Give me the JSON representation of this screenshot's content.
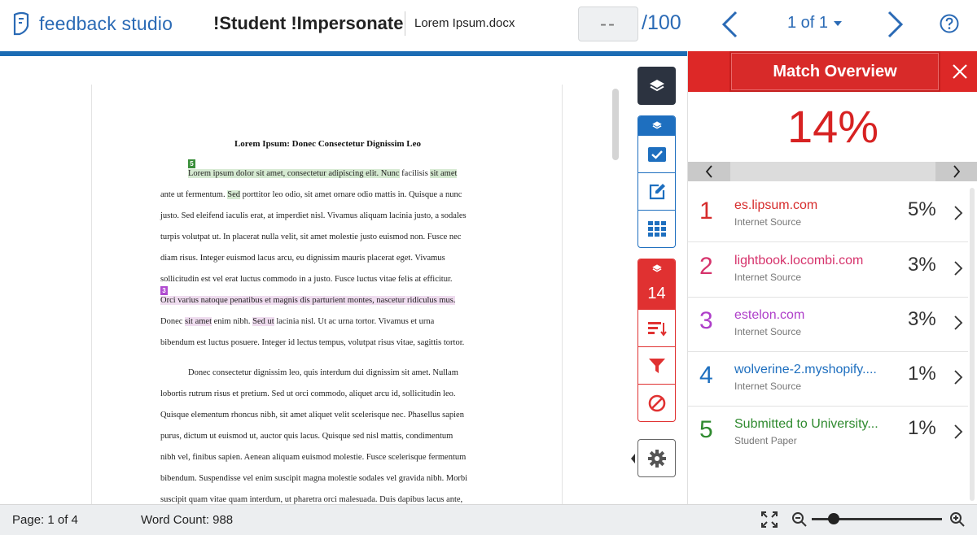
{
  "header": {
    "app_name": "feedback studio",
    "student_name": "!Student !Impersonate",
    "document_name": "Lorem Ipsum.docx",
    "grade_value": "--",
    "grade_max": "/100",
    "page_selector": "1 of 1"
  },
  "document": {
    "title": "Lorem Ipsum: Donec Consectetur Dignissim Leo",
    "badge_green": "5",
    "badge_purple": "3",
    "p1": {
      "l1_hl": "Lorem ipsum dolor sit amet, consectetur adipiscing elit. Nunc",
      "l1_mid": " facilisis ",
      "l1_hl2": "sit amet",
      "l2_a": "ante ut fermentum. ",
      "l2_hl": "Sed",
      "l2_b": " porttitor leo odio, sit amet ornare odio mattis in. Quisque a nunc",
      "l3": "justo. Sed eleifend iaculis erat, at imperdiet nisl. Vivamus aliquam lacinia justo, a sodales",
      "l4": "turpis volutpat ut. In placerat nulla velit, sit amet molestie justo euismod non. Fusce nec",
      "l5": "diam risus. Integer euismod lacus arcu, eu dignissim mauris placerat eget. Vivamus",
      "l6": "sollicitudin est vel erat luctus commodo in a justo. Fusce luctus vitae felis at efficitur.",
      "l7_hl": "Orci varius natoque penatibus et magnis dis parturient montes, nascetur ridiculus mus.",
      "l8_a": "Donec ",
      "l8_hl": "sit amet",
      "l8_b": " enim nibh. ",
      "l8_hl2": "Sed ut",
      "l8_c": " lacinia nisl. Ut ac urna tortor. Vivamus et urna",
      "l9": "bibendum est luctus posuere. Integer id lectus tempus, volutpat risus vitae, sagittis tortor."
    },
    "p2": {
      "l1": "Donec consectetur dignissim leo, quis interdum dui dignissim sit amet. Nullam",
      "l2": "lobortis rutrum risus et pretium. Sed ut orci commodo, aliquet arcu id, sollicitudin leo.",
      "l3": "Quisque elementum rhoncus nibh, sit amet aliquet velit scelerisque nec. Phasellus sapien",
      "l4": "purus, dictum ut euismod ut, auctor quis lacus. Quisque sed nisl mattis, condimentum",
      "l5": "nibh vel, finibus sapien. Aenean aliquam euismod molestie. Fusce scelerisque fermentum",
      "l6": "bibendum. Suspendisse vel enim suscipit magna molestie sodales vel gravida nibh. Morbi",
      "l7": "suscipit quam vitae quam interdum, ut pharetra orci malesuada. Duis dapibus lacus ante,"
    }
  },
  "tools": {
    "similarity_count": "14"
  },
  "panel": {
    "title": "Match Overview",
    "overall_percent": "14%",
    "matches": [
      {
        "num": "1",
        "source": "es.lipsum.com",
        "type": "Internet Source",
        "percent": "5%",
        "color": "#d62b2b"
      },
      {
        "num": "2",
        "source": "lightbook.locombi.com",
        "type": "Internet Source",
        "percent": "3%",
        "color": "#d6336c"
      },
      {
        "num": "3",
        "source": "estelon.com",
        "type": "Internet Source",
        "percent": "3%",
        "color": "#ae3ec9"
      },
      {
        "num": "4",
        "source": "wolverine-2.myshopify....",
        "type": "Internet Source",
        "percent": "1%",
        "color": "#1e6fbf"
      },
      {
        "num": "5",
        "source": "Submitted to University...",
        "type": "Student Paper",
        "percent": "1%",
        "color": "#2f8a2f"
      }
    ]
  },
  "status": {
    "page_label": "Page: 1 of 4",
    "word_count": "Word Count: 988",
    "zoom_level": 0.17
  },
  "colors": {
    "brand_blue": "#1c6cb4",
    "similarity_red": "#dd2827",
    "tool_dark": "#2c3340"
  }
}
